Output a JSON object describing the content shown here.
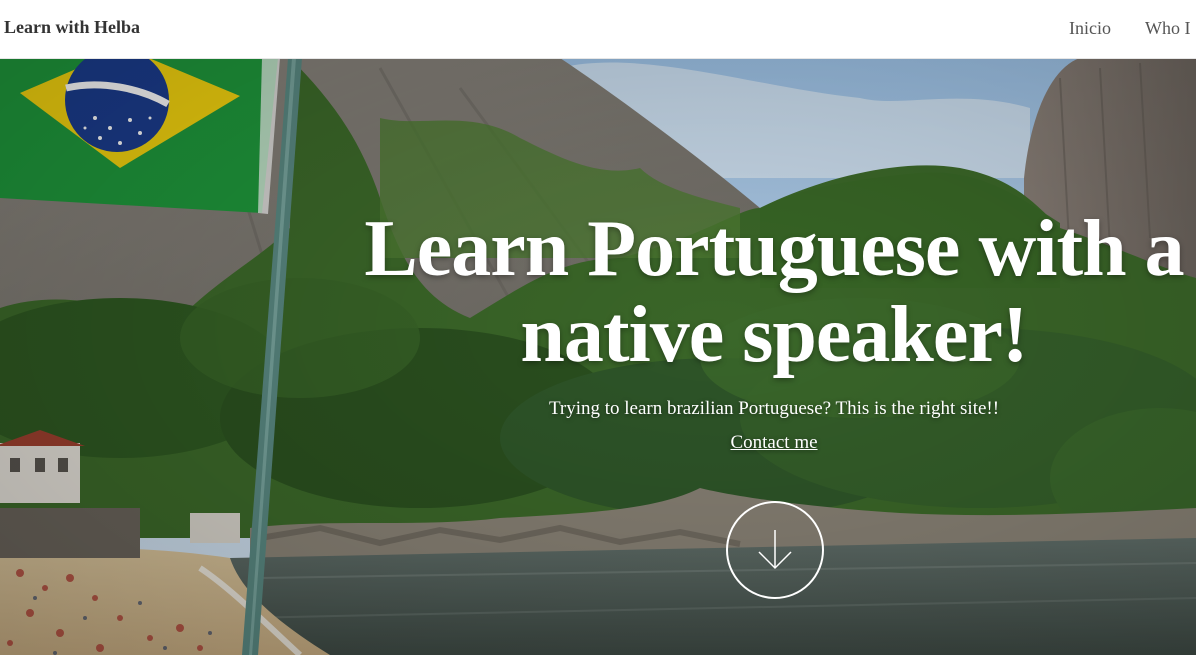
{
  "navbar": {
    "brand": "Learn with Helba",
    "links": [
      {
        "label": "Inicio"
      },
      {
        "label": "Who I"
      }
    ]
  },
  "hero": {
    "title": "Learn Portuguese with a native speaker!",
    "subtitle": "Trying to learn brazilian Portuguese? This is the right site!!",
    "contact_label": "Contact me",
    "scroll_icon": "arrow-down-circle-icon"
  },
  "colors": {
    "navbar_bg": "#ffffff",
    "brand_text": "#333333",
    "nav_text": "#555555",
    "hero_text": "#ffffff",
    "flag_green": "#1f9a3c",
    "flag_yellow": "#f5d50f",
    "flag_blue": "#1b3d8f"
  }
}
